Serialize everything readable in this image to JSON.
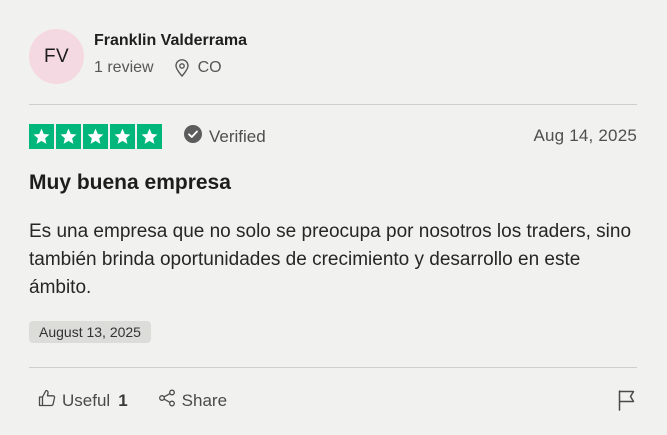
{
  "reviewer": {
    "initials": "FV",
    "name": "Franklin Valderrama",
    "review_count": "1 review",
    "country": "CO"
  },
  "review": {
    "rating": 5,
    "verified_label": "Verified",
    "date": "Aug 14, 2025",
    "title": "Muy buena empresa",
    "body": "Es una empresa que no solo se preocupa por nosotros los traders, sino también brinda oportunidades de crecimiento y desarrollo en este ámbito.",
    "experience_date": "August 13, 2025"
  },
  "actions": {
    "useful_label": "Useful",
    "useful_count": "1",
    "share_label": "Share"
  },
  "colors": {
    "star_green": "#00b67a",
    "avatar_bg": "#f5d9e2",
    "card_bg": "#f1f1ef"
  },
  "icons": [
    "location-pin-icon",
    "star-icon",
    "verified-check-icon",
    "thumbs-up-icon",
    "share-icon",
    "flag-icon"
  ]
}
